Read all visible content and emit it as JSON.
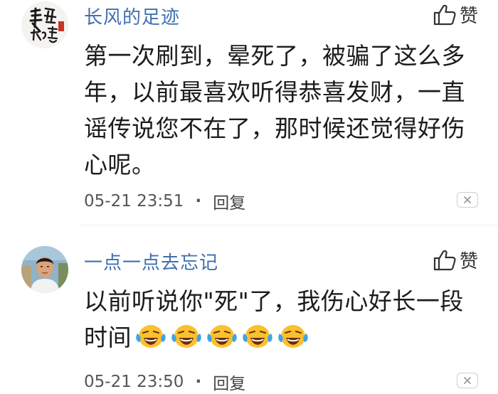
{
  "comments": [
    {
      "username": "长风的足迹",
      "like_label": "赞",
      "content": "第一次刷到，晕死了，被骗了这么多年，以前最喜欢听得恭喜发财，一直谣传说您不在了，那时候还觉得好伤心呢。",
      "timestamp": "05-21 23:51",
      "separator": "·",
      "reply_label": "回复",
      "avatar_text": "長留 成慧"
    },
    {
      "username": "一点一点去忘记",
      "like_label": "赞",
      "content": "以前听说你\"死\"了，我伤心好长一段时间",
      "emojis": [
        "crying-laughing-emoji",
        "crying-laughing-emoji",
        "crying-laughing-emoji",
        "crying-laughing-emoji",
        "crying-laughing-emoji"
      ],
      "timestamp": "05-21 23:50",
      "separator": "·",
      "reply_label": "回复"
    }
  ],
  "colors": {
    "username": "#3f6fb0",
    "text": "#1c1c1c",
    "meta": "#555555",
    "emoji_face": "#fbc02d",
    "emoji_tears": "#3ba4ea"
  },
  "icons": [
    "thumbs-up-icon",
    "close-icon"
  ]
}
